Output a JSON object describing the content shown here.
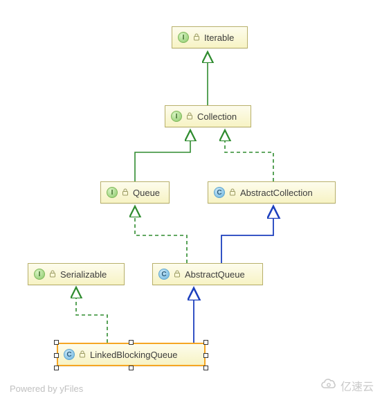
{
  "diagram": {
    "nodes": {
      "iterable": {
        "kind": "I",
        "label": "Iterable"
      },
      "collection": {
        "kind": "I",
        "label": "Collection"
      },
      "queue": {
        "kind": "I",
        "label": "Queue"
      },
      "abstractCollection": {
        "kind": "C",
        "label": "AbstractCollection"
      },
      "serializable": {
        "kind": "I",
        "label": "Serializable"
      },
      "abstractQueue": {
        "kind": "C",
        "label": "AbstractQueue"
      },
      "linkedBlockingQueue": {
        "kind": "C",
        "label": "LinkedBlockingQueue",
        "selected": true
      }
    },
    "edges": [
      {
        "from": "collection",
        "to": "iterable",
        "style": "extendsInterface"
      },
      {
        "from": "queue",
        "to": "collection",
        "style": "extendsInterface"
      },
      {
        "from": "abstractCollection",
        "to": "collection",
        "style": "implements"
      },
      {
        "from": "abstractQueue",
        "to": "queue",
        "style": "implements"
      },
      {
        "from": "abstractQueue",
        "to": "abstractCollection",
        "style": "extendsClass"
      },
      {
        "from": "linkedBlockingQueue",
        "to": "serializable",
        "style": "implements"
      },
      {
        "from": "linkedBlockingQueue",
        "to": "abstractQueue",
        "style": "extendsClass"
      }
    ],
    "legendStyles": {
      "extendsInterface": {
        "color": "#2e8b2e",
        "dashed": false,
        "desc": "interface extends (solid green)"
      },
      "implements": {
        "color": "#2e8b2e",
        "dashed": true,
        "desc": "implements (dashed green)"
      },
      "extendsClass": {
        "color": "#1c3fbd",
        "dashed": false,
        "desc": "class extends (solid blue)"
      }
    }
  },
  "footer": {
    "poweredBy": "Powered by yFiles",
    "brand": "亿速云"
  }
}
